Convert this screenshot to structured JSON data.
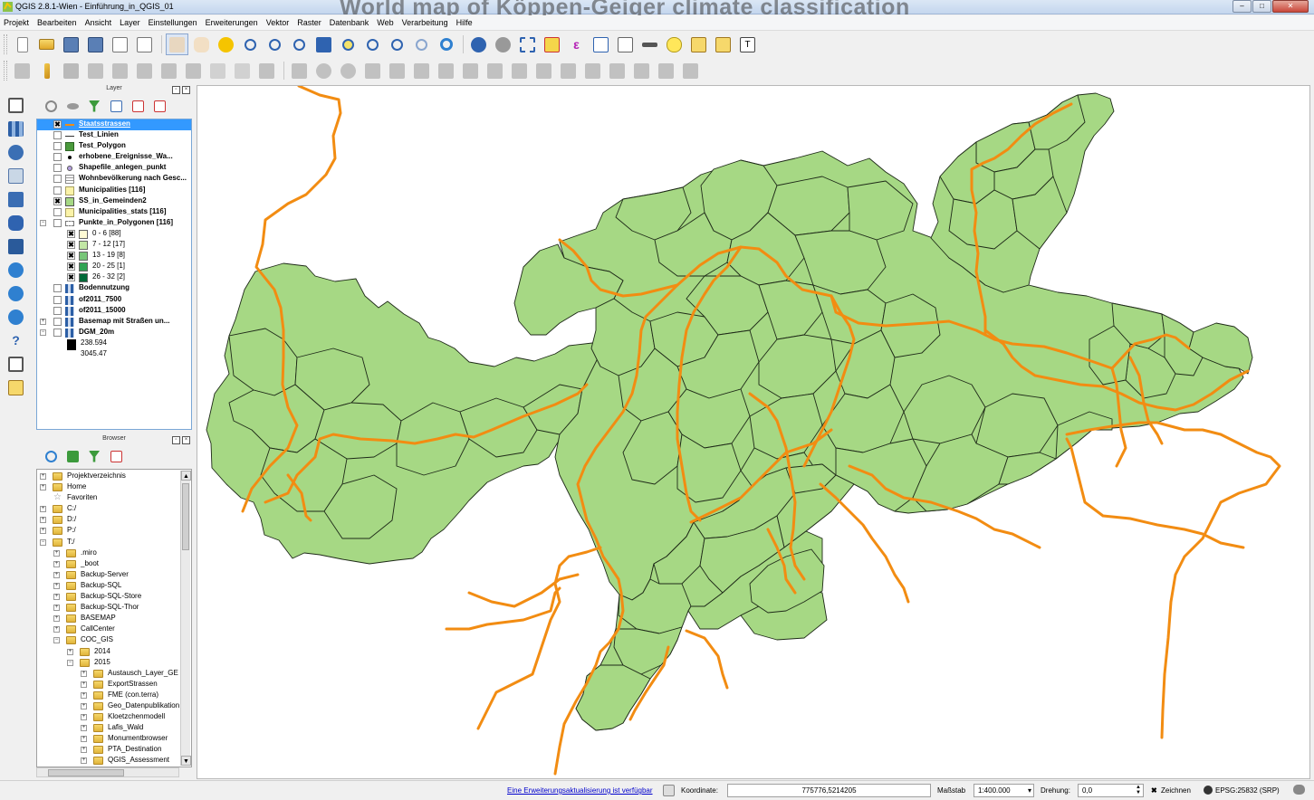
{
  "window": {
    "title": "QGIS 2.8.1-Wien - Einführung_in_QGIS_01",
    "background_title": "World map of Köppen-Geiger climate classification",
    "buttons": {
      "minimize": "–",
      "maximize": "□",
      "close": "✕"
    }
  },
  "menubar": {
    "items": [
      "Projekt",
      "Bearbeiten",
      "Ansicht",
      "Layer",
      "Einstellungen",
      "Erweiterungen",
      "Vektor",
      "Raster",
      "Datenbank",
      "Web",
      "Verarbeitung",
      "Hilfe"
    ]
  },
  "layer_panel": {
    "title": "Layer",
    "layers": [
      {
        "label": "Staatsstrassen",
        "checked": true,
        "symbol": "line-orange",
        "selected": true,
        "indent": 0
      },
      {
        "label": "Test_Linien",
        "checked": false,
        "symbol": "line-dark",
        "indent": 0
      },
      {
        "label": "Test_Polygon",
        "checked": false,
        "symbol": "fill-green",
        "indent": 0
      },
      {
        "label": "erhobene_Ereignisse_Wa...",
        "checked": false,
        "symbol": "point-black",
        "indent": 0
      },
      {
        "label": "Shapefile_anlegen_punkt",
        "checked": false,
        "symbol": "point-purple",
        "indent": 0
      },
      {
        "label": "Wohnbevölkerung nach Gesc...",
        "checked": false,
        "symbol": "table",
        "indent": 0
      },
      {
        "label": "Municipalities [116]",
        "checked": false,
        "symbol": "fill-yellow",
        "indent": 0
      },
      {
        "label": "SS_in_Gemeinden2",
        "checked": true,
        "symbol": "fill-lightgreen",
        "indent": 0
      },
      {
        "label": "Municipalities_stats [116]",
        "checked": false,
        "symbol": "fill-yellow",
        "indent": 0
      },
      {
        "label": "Punkte_in_Polygonen [116]",
        "checked": false,
        "symbol": "group",
        "indent": 0,
        "expanded": true
      },
      {
        "label": "0 - 6 [88]",
        "checked": true,
        "symbol": "class-1",
        "indent": 1
      },
      {
        "label": "7 - 12 [17]",
        "checked": true,
        "symbol": "class-2",
        "indent": 1
      },
      {
        "label": "13 - 19 [8]",
        "checked": true,
        "symbol": "class-3",
        "indent": 1
      },
      {
        "label": "20 - 25 [1]",
        "checked": true,
        "symbol": "class-4",
        "indent": 1
      },
      {
        "label": "26 - 32 [2]",
        "checked": true,
        "symbol": "class-5",
        "indent": 1
      },
      {
        "label": "Bodennutzung",
        "checked": false,
        "symbol": "raster",
        "indent": 0
      },
      {
        "label": "of2011_7500",
        "checked": false,
        "symbol": "raster",
        "indent": 0
      },
      {
        "label": "of2011_15000",
        "checked": false,
        "symbol": "raster",
        "indent": 0
      },
      {
        "label": "Basemap mit Straßen un...",
        "checked": false,
        "symbol": "raster",
        "indent": 0,
        "expandable": true
      },
      {
        "label": "DGM_20m",
        "checked": false,
        "symbol": "raster",
        "indent": 0,
        "expanded": true
      },
      {
        "label": "238.594",
        "symbol": "ramp-black",
        "indent": 1,
        "legend": true
      },
      {
        "label": "3045.47",
        "symbol": "ramp-white",
        "indent": 1,
        "legend": true
      }
    ]
  },
  "browser_panel": {
    "title": "Browser",
    "items": [
      {
        "label": "Projektverzeichnis",
        "indent": 0,
        "type": "folder"
      },
      {
        "label": "Home",
        "indent": 0,
        "type": "folder"
      },
      {
        "label": "Favoriten",
        "indent": 0,
        "type": "star"
      },
      {
        "label": "C:/",
        "indent": 0,
        "type": "folder"
      },
      {
        "label": "D:/",
        "indent": 0,
        "type": "folder"
      },
      {
        "label": "P:/",
        "indent": 0,
        "type": "folder"
      },
      {
        "label": "T:/",
        "indent": 0,
        "type": "folder",
        "expanded": true
      },
      {
        "label": ".miro",
        "indent": 1,
        "type": "folder"
      },
      {
        "label": "_boot",
        "indent": 1,
        "type": "folder"
      },
      {
        "label": "Backup-Server",
        "indent": 1,
        "type": "folder"
      },
      {
        "label": "Backup-SQL",
        "indent": 1,
        "type": "folder"
      },
      {
        "label": "Backup-SQL-Store",
        "indent": 1,
        "type": "folder"
      },
      {
        "label": "Backup-SQL-Thor",
        "indent": 1,
        "type": "folder"
      },
      {
        "label": "BASEMAP",
        "indent": 1,
        "type": "folder"
      },
      {
        "label": "CallCenter",
        "indent": 1,
        "type": "folder"
      },
      {
        "label": "COC_GIS",
        "indent": 1,
        "type": "folder",
        "expanded": true
      },
      {
        "label": "2014",
        "indent": 2,
        "type": "folder"
      },
      {
        "label": "2015",
        "indent": 2,
        "type": "folder",
        "expanded": true
      },
      {
        "label": "Austausch_Layer_GE",
        "indent": 3,
        "type": "folder"
      },
      {
        "label": "ExportStrassen",
        "indent": 3,
        "type": "folder"
      },
      {
        "label": "FME (con.terra)",
        "indent": 3,
        "type": "folder"
      },
      {
        "label": "Geo_Datenpublikation",
        "indent": 3,
        "type": "folder"
      },
      {
        "label": "Kloetzchenmodell",
        "indent": 3,
        "type": "folder"
      },
      {
        "label": "Lafis_Wald",
        "indent": 3,
        "type": "folder"
      },
      {
        "label": "Monumentbrowser",
        "indent": 3,
        "type": "folder"
      },
      {
        "label": "PTA_Destination",
        "indent": 3,
        "type": "folder"
      },
      {
        "label": "QGIS_Assessment",
        "indent": 3,
        "type": "folder"
      }
    ]
  },
  "statusbar": {
    "update_link": "Eine Erweiterungsaktualisierung ist verfügbar",
    "coord_label": "Koordinate:",
    "coord_value": "775776,5214205",
    "scale_label": "Maßstab",
    "scale_value": "1:400.000",
    "rotation_label": "Drehung:",
    "rotation_value": "0,0",
    "render_label": "Zeichnen",
    "crs_label": "EPSG:25832 (SRP)"
  },
  "colors": {
    "polygon_fill": "#a6d884",
    "polygon_stroke": "#1e2a18",
    "road": "#f28c12",
    "selection": "#3399ff"
  }
}
